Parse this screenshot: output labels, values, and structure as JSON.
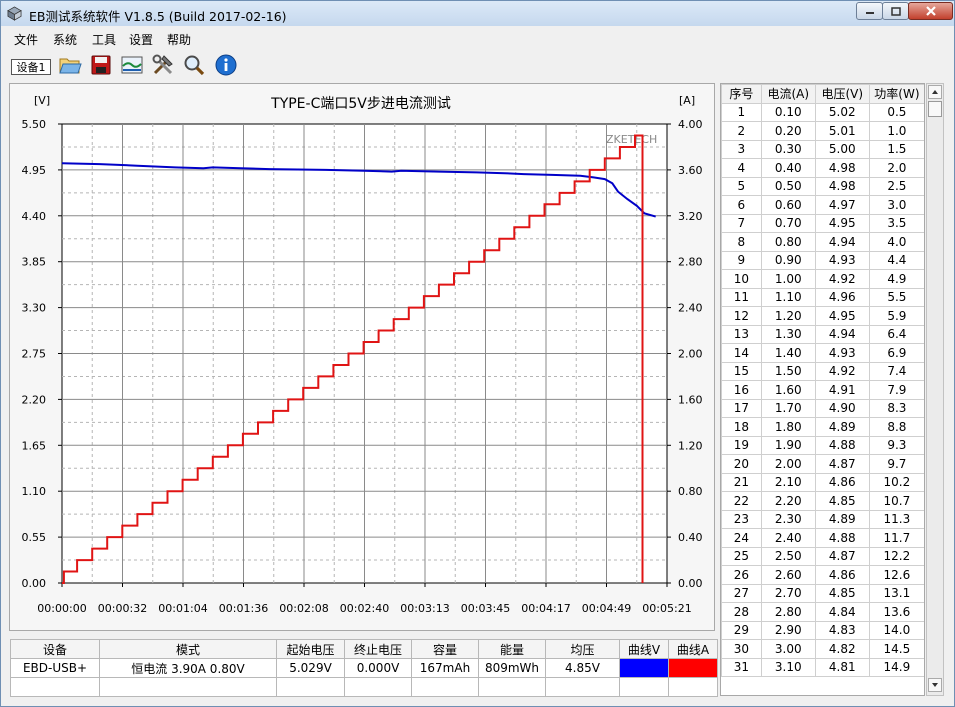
{
  "window": {
    "title": "EB测试系统软件 V1.8.5 (Build 2017-02-16)"
  },
  "menu": [
    "文件",
    "系统",
    "工具",
    "设置",
    "帮助"
  ],
  "toolbar": {
    "device_tab": "设备1"
  },
  "chart_data": {
    "type": "line",
    "title": "TYPE-C端口5V步进电流测试",
    "watermark": "ZKETECH",
    "y_left_unit": "[V]",
    "y_right_unit": "[A]",
    "ylim_left": [
      0,
      5.5
    ],
    "ylim_right": [
      0,
      4.0
    ],
    "y_left_ticks": [
      "5.50",
      "4.95",
      "4.40",
      "3.85",
      "3.30",
      "2.75",
      "2.20",
      "1.65",
      "1.10",
      "0.55",
      "0.00"
    ],
    "y_right_ticks": [
      "4.00",
      "3.60",
      "3.20",
      "2.80",
      "2.40",
      "2.00",
      "1.60",
      "1.20",
      "0.80",
      "0.40",
      "0.00"
    ],
    "x_ticks": [
      "00:00:00",
      "00:00:32",
      "00:01:04",
      "00:01:36",
      "00:02:08",
      "00:02:40",
      "00:03:13",
      "00:03:45",
      "00:04:17",
      "00:04:49",
      "00:05:21"
    ],
    "xlim": [
      "00:00:00",
      "00:05:21"
    ],
    "grid": true,
    "series": [
      {
        "axis": "left",
        "color": "#0000c8",
        "points": [
          [
            0,
            5.03
          ],
          [
            20,
            5.02
          ],
          [
            40,
            5.0
          ],
          [
            60,
            4.98
          ],
          [
            75,
            4.97
          ],
          [
            80,
            4.98
          ],
          [
            95,
            4.97
          ],
          [
            110,
            4.96
          ],
          [
            140,
            4.95
          ],
          [
            160,
            4.94
          ],
          [
            175,
            4.93
          ],
          [
            180,
            4.94
          ],
          [
            200,
            4.93
          ],
          [
            220,
            4.92
          ],
          [
            235,
            4.91
          ],
          [
            245,
            4.9
          ],
          [
            260,
            4.89
          ],
          [
            275,
            4.88
          ],
          [
            282,
            4.86
          ],
          [
            288,
            4.84
          ],
          [
            292,
            4.79
          ],
          [
            295,
            4.69
          ],
          [
            300,
            4.6
          ],
          [
            305,
            4.52
          ],
          [
            309,
            4.43
          ],
          [
            315,
            4.39
          ]
        ]
      },
      {
        "axis": "right",
        "color": "#e01414",
        "points": [
          [
            0,
            0.0
          ],
          [
            1,
            0.1
          ],
          [
            8,
            0.2
          ],
          [
            16,
            0.3
          ],
          [
            24,
            0.4
          ],
          [
            32,
            0.5
          ],
          [
            40,
            0.6
          ],
          [
            48,
            0.7
          ],
          [
            56,
            0.8
          ],
          [
            64,
            0.9
          ],
          [
            72,
            1.0
          ],
          [
            80,
            1.1
          ],
          [
            88,
            1.2
          ],
          [
            96,
            1.3
          ],
          [
            104,
            1.4
          ],
          [
            112,
            1.5
          ],
          [
            120,
            1.6
          ],
          [
            128,
            1.7
          ],
          [
            136,
            1.8
          ],
          [
            144,
            1.9
          ],
          [
            152,
            2.0
          ],
          [
            160,
            2.1
          ],
          [
            168,
            2.2
          ],
          [
            176,
            2.3
          ],
          [
            184,
            2.4
          ],
          [
            192,
            2.5
          ],
          [
            200,
            2.6
          ],
          [
            208,
            2.7
          ],
          [
            216,
            2.8
          ],
          [
            224,
            2.9
          ],
          [
            232,
            3.0
          ],
          [
            240,
            3.1
          ],
          [
            248,
            3.2
          ],
          [
            256,
            3.3
          ],
          [
            264,
            3.4
          ],
          [
            272,
            3.5
          ],
          [
            280,
            3.6
          ],
          [
            288,
            3.7
          ],
          [
            296,
            3.8
          ],
          [
            304,
            3.9
          ]
        ],
        "drop_at": 308
      }
    ]
  },
  "table": {
    "headers": [
      "序号",
      "电流(A)",
      "电压(V)",
      "功率(W)"
    ],
    "rows": [
      [
        "1",
        "0.10",
        "5.02",
        "0.5"
      ],
      [
        "2",
        "0.20",
        "5.01",
        "1.0"
      ],
      [
        "3",
        "0.30",
        "5.00",
        "1.5"
      ],
      [
        "4",
        "0.40",
        "4.98",
        "2.0"
      ],
      [
        "5",
        "0.50",
        "4.98",
        "2.5"
      ],
      [
        "6",
        "0.60",
        "4.97",
        "3.0"
      ],
      [
        "7",
        "0.70",
        "4.95",
        "3.5"
      ],
      [
        "8",
        "0.80",
        "4.94",
        "4.0"
      ],
      [
        "9",
        "0.90",
        "4.93",
        "4.4"
      ],
      [
        "10",
        "1.00",
        "4.92",
        "4.9"
      ],
      [
        "11",
        "1.10",
        "4.96",
        "5.5"
      ],
      [
        "12",
        "1.20",
        "4.95",
        "5.9"
      ],
      [
        "13",
        "1.30",
        "4.94",
        "6.4"
      ],
      [
        "14",
        "1.40",
        "4.93",
        "6.9"
      ],
      [
        "15",
        "1.50",
        "4.92",
        "7.4"
      ],
      [
        "16",
        "1.60",
        "4.91",
        "7.9"
      ],
      [
        "17",
        "1.70",
        "4.90",
        "8.3"
      ],
      [
        "18",
        "1.80",
        "4.89",
        "8.8"
      ],
      [
        "19",
        "1.90",
        "4.88",
        "9.3"
      ],
      [
        "20",
        "2.00",
        "4.87",
        "9.7"
      ],
      [
        "21",
        "2.10",
        "4.86",
        "10.2"
      ],
      [
        "22",
        "2.20",
        "4.85",
        "10.7"
      ],
      [
        "23",
        "2.30",
        "4.89",
        "11.3"
      ],
      [
        "24",
        "2.40",
        "4.88",
        "11.7"
      ],
      [
        "25",
        "2.50",
        "4.87",
        "12.2"
      ],
      [
        "26",
        "2.60",
        "4.86",
        "12.6"
      ],
      [
        "27",
        "2.70",
        "4.85",
        "13.1"
      ],
      [
        "28",
        "2.80",
        "4.84",
        "13.6"
      ],
      [
        "29",
        "2.90",
        "4.83",
        "14.0"
      ],
      [
        "30",
        "3.00",
        "4.82",
        "14.5"
      ],
      [
        "31",
        "3.10",
        "4.81",
        "14.9"
      ]
    ]
  },
  "summary": {
    "headers": [
      "设备",
      "模式",
      "起始电压",
      "终止电压",
      "容量",
      "能量",
      "均压",
      "曲线V",
      "曲线A"
    ],
    "values": [
      "EBD-USB+",
      "恒电流 3.90A 0.80V",
      "5.029V",
      "0.000V",
      "167mAh",
      "809mWh",
      "4.85V"
    ],
    "curve_v_color": "#0000ff",
    "curve_a_color": "#ff0000"
  }
}
